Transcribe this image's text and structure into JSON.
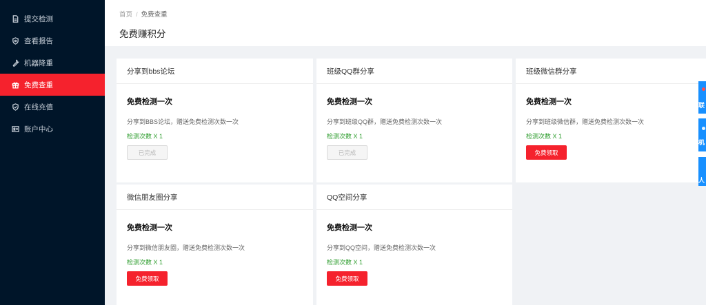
{
  "sidebar": {
    "items": [
      {
        "label": "提交检测",
        "icon": "document-icon",
        "active": false
      },
      {
        "label": "查看报告",
        "icon": "shield-icon",
        "active": false
      },
      {
        "label": "机器降重",
        "icon": "wrench-icon",
        "active": false
      },
      {
        "label": "免费查重",
        "icon": "gift-icon",
        "active": true
      },
      {
        "label": "在线充值",
        "icon": "shield-check-icon",
        "active": false
      },
      {
        "label": "账户中心",
        "icon": "id-card-icon",
        "active": false
      }
    ]
  },
  "header": {
    "breadcrumb": {
      "home": "首页",
      "separator": "/",
      "current": "免费查重"
    },
    "title": "免费赚积分"
  },
  "cards": [
    {
      "title": "分享到bbs论坛",
      "heading": "免费检测一次",
      "desc": "分享到BBS论坛，赠送免费检测次数一次",
      "reward": "检测次数 X 1",
      "button": "已完成",
      "state": "done"
    },
    {
      "title": "班级QQ群分享",
      "heading": "免费检测一次",
      "desc": "分享到班级QQ群，赠送免费检测次数一次",
      "reward": "检测次数 X 1",
      "button": "已完成",
      "state": "done"
    },
    {
      "title": "班级微信群分享",
      "heading": "免费检测一次",
      "desc": "分享到班级微信群，赠送免费检测次数一次",
      "reward": "检测次数 X 1",
      "button": "免费领取",
      "state": "claim"
    },
    {
      "title": "微信朋友圈分享",
      "heading": "免费检测一次",
      "desc": "分享到微信朋友圈，赠送免费检测次数一次",
      "reward": "检测次数 X 1",
      "button": "免费领取",
      "state": "claim"
    },
    {
      "title": "QQ空间分享",
      "heading": "免费检测一次",
      "desc": "分享到QQ空间，赠送免费检测次数一次",
      "reward": "检测次数 X 1",
      "button": "免费领取",
      "state": "claim"
    }
  ],
  "float_tabs": [
    {
      "label": "联"
    },
    {
      "label": "机"
    },
    {
      "label": "人"
    }
  ],
  "colors": {
    "sidebar_bg": "#001529",
    "accent_red": "#f5222d",
    "reward_green": "#2e9d2e",
    "float_blue": "#1890ff"
  }
}
